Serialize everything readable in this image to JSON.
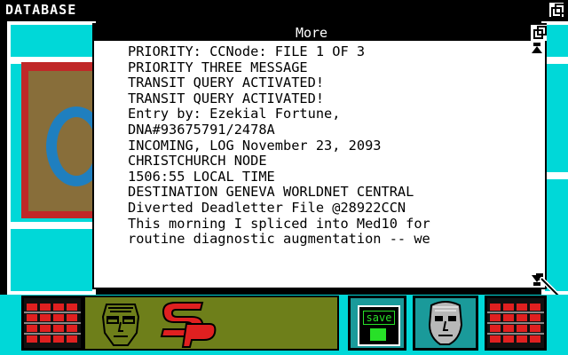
{
  "window": {
    "title": "DATABASE"
  },
  "dialog": {
    "title": "More",
    "lines": [
      "PRIORITY: CCNode: FILE 1 OF 3",
      "",
      "PRIORITY THREE MESSAGE",
      "TRANSIT QUERY ACTIVATED!",
      "TRANSIT QUERY ACTIVATED!",
      "Entry by: Ezekial Fortune,",
      "DNA#93675791/2478A",
      "INCOMING, LOG November 23, 2093",
      "CHRISTCHURCH NODE",
      "1506:55 LOCAL TIME",
      "DESTINATION GENEVA WORLDNET CENTRAL",
      "Diverted Deadletter File @28922CCN",
      "",
      "This morning I spliced into Med10 for",
      "routine diagnostic augmentation -- we"
    ]
  },
  "toolbar": {
    "save_label": "save"
  },
  "colors": {
    "desktop": "#00d8d8",
    "dialog_title_bg": "#000000",
    "save_text": "#28e028",
    "logo_red": "#e02020",
    "mid_panel": "#6e7f1a"
  },
  "icons": {
    "left_grid": "red-grid-icon",
    "face": "wireframe-face-icon",
    "logo": "sp-logo-icon",
    "save": "floppy-disk-icon",
    "statue": "stone-head-icon",
    "right_grid": "red-grid-icon"
  }
}
